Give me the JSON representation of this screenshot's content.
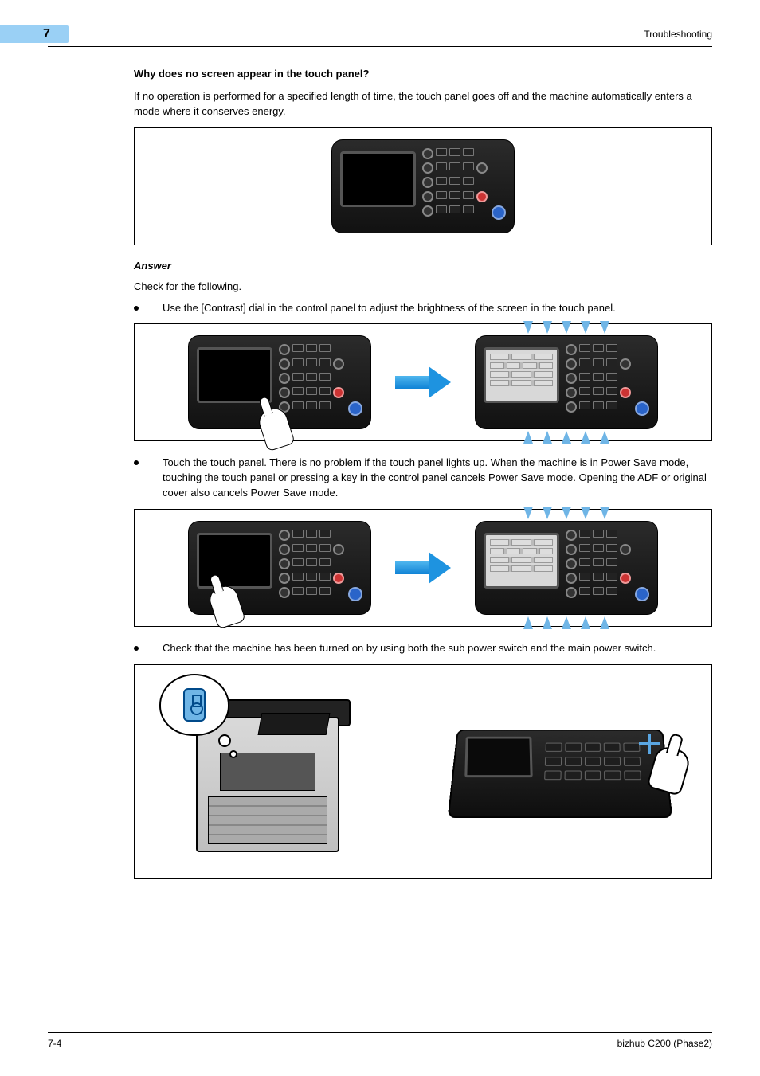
{
  "header": {
    "chapter_number": "7",
    "right_text": "Troubleshooting"
  },
  "content": {
    "question_heading": "Why does no screen appear in the touch panel?",
    "intro_paragraph": "If no operation is performed for a specified length of time, the touch panel goes off and the machine automatically enters a mode where it conserves energy.",
    "answer_heading": "Answer",
    "answer_intro": "Check for the following.",
    "bullets": [
      "Use the [Contrast] dial in the control panel to adjust the brightness of the screen in the touch panel.",
      "Touch the touch panel. There is no problem if the touch panel lights up. When the machine is in Power Save mode, touching the touch panel or pressing a key in the control panel cancels Power Save mode. Opening the ADF or original cover also cancels Power Save mode.",
      "Check that the machine has been turned on by using both the sub power switch and the main power switch."
    ]
  },
  "footer": {
    "page_number": "7-4",
    "product": "bizhub C200 (Phase2)"
  }
}
